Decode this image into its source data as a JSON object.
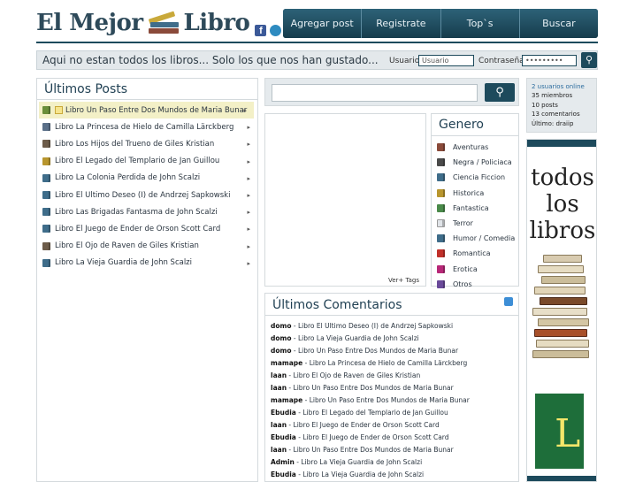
{
  "header": {
    "logo_left": "El Mejor",
    "logo_right": "Libro",
    "facebook_glyph": "f"
  },
  "nav": [
    "Agregar post",
    "Registrate",
    "Top`s",
    "Buscar"
  ],
  "banner": {
    "text": "Aqui no estan todos los libros... Solo los que nos han gustado...",
    "user_label": "Usuario",
    "user_value": "Usuario",
    "pass_label": "Contraseña",
    "pass_value": "•••••••••"
  },
  "posts": {
    "title": "Últimos Posts",
    "items": [
      {
        "label": "Libro Un Paso Entre Dos Mundos de Maria Bunar",
        "color": "#6a8e3a"
      },
      {
        "label": "Libro La Princesa de Hielo de Camilla Lärckberg",
        "color": "#5a6f88"
      },
      {
        "label": "Libro Los Hijos del Trueno de Giles Kristian",
        "color": "#6d5c4a"
      },
      {
        "label": "Libro El Legado del Templario de Jan Guillou",
        "color": "#b8962e"
      },
      {
        "label": "Libro La Colonia Perdida de John Scalzi",
        "color": "#3f6d8a"
      },
      {
        "label": "Libro El Ultimo Deseo (I) de Andrzej Sapkowski",
        "color": "#3f6d8a"
      },
      {
        "label": "Libro Las Brigadas Fantasma de John Scalzi",
        "color": "#3f6d8a"
      },
      {
        "label": "Libro El Juego de Ender de Orson Scott Card",
        "color": "#3f6d8a"
      },
      {
        "label": "Libro El Ojo de Raven de Giles Kristian",
        "color": "#6d5c4a"
      },
      {
        "label": "Libro La Vieja Guardia de John Scalzi",
        "color": "#3f6d8a"
      }
    ]
  },
  "tags": {
    "more": "Ver+ Tags"
  },
  "genero": {
    "title": "Genero",
    "items": [
      {
        "label": "Aventuras",
        "color": "#8a4a3a"
      },
      {
        "label": "Negra / Policiaca",
        "color": "#4a4a4a"
      },
      {
        "label": "Ciencia Ficcion",
        "color": "#3f6d8a"
      },
      {
        "label": "Historica",
        "color": "#b8962e"
      },
      {
        "label": "Fantastica",
        "color": "#4a8a4a"
      },
      {
        "label": "Terror",
        "color": "#e0e4e8"
      },
      {
        "label": "Humor / Comedia",
        "color": "#3f6d8a"
      },
      {
        "label": "Romantica",
        "color": "#c0302a"
      },
      {
        "label": "Erotica",
        "color": "#b82878"
      },
      {
        "label": "Otros",
        "color": "#6a4a9a"
      }
    ]
  },
  "comments": {
    "title": "Últimos Comentarios",
    "items": [
      {
        "user": "domo",
        "text": " - Libro El Ultimo Deseo (I) de Andrzej Sapkowski"
      },
      {
        "user": "domo",
        "text": " - Libro La Vieja Guardia de John Scalzi"
      },
      {
        "user": "domo",
        "text": " - Libro Un Paso Entre Dos Mundos de Maria Bunar"
      },
      {
        "user": "mamape",
        "text": " - Libro La Princesa de Hielo de Camilla Lärckberg"
      },
      {
        "user": "laan",
        "text": " - Libro El Ojo de Raven de Giles Kristian"
      },
      {
        "user": "laan",
        "text": " - Libro Un Paso Entre Dos Mundos de Maria Bunar"
      },
      {
        "user": "mamape",
        "text": " - Libro Un Paso Entre Dos Mundos de Maria Bunar"
      },
      {
        "user": "Ebudia",
        "text": " - Libro El Legado del Templario de Jan Guillou"
      },
      {
        "user": "laan",
        "text": " - Libro El Juego de Ender de Orson Scott Card"
      },
      {
        "user": "Ebudia",
        "text": " - Libro El Juego de Ender de Orson Scott Card"
      },
      {
        "user": "laan",
        "text": " - Libro Un Paso Entre Dos Mundos de Maria Bunar"
      },
      {
        "user": "Admin",
        "text": " - Libro La Vieja Guardia de John Scalzi"
      },
      {
        "user": "Ebudia",
        "text": " - Libro La Vieja Guardia de John Scalzi"
      }
    ]
  },
  "stats": {
    "online": "2 usuarios online",
    "members": "35 miembros",
    "posts": "10 posts",
    "comments": "13 comentarios",
    "last": "Último: draiip"
  },
  "ad": {
    "line1": "todos",
    "line2": "los",
    "line3": "libros",
    "mark": "L"
  },
  "colors": {
    "accent": "#1d4a5c",
    "panel_bg": "#e5eaed",
    "active_row": "#f3f0c7"
  }
}
